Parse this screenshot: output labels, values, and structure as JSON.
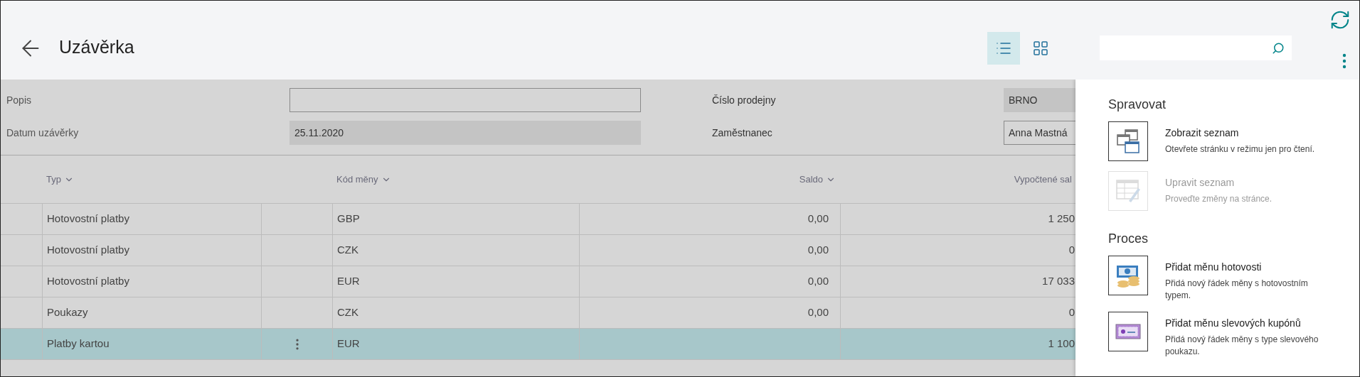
{
  "header": {
    "title": "Uzávěrka",
    "views": [
      {
        "kind": "list",
        "selected": true
      },
      {
        "kind": "tiles",
        "selected": false
      }
    ]
  },
  "form": {
    "left": [
      {
        "label": "Popis",
        "kind": "input"
      },
      {
        "label": "Datum uzávěrky",
        "kind": "readonly",
        "value": "25.11.2020"
      }
    ],
    "right": [
      {
        "label": "Číslo prodejny",
        "kind": "readonly",
        "value": "BRNO"
      },
      {
        "label": "Zaměstnanec",
        "kind": "input",
        "value": "Anna Mastná"
      }
    ]
  },
  "table": {
    "columns": [
      {
        "label": "Typ",
        "sort_menu": true
      },
      {
        "label": "Kód měny",
        "sort_menu": true
      },
      {
        "label": "Saldo",
        "sort_menu": true
      },
      {
        "label": "Vypočtené sal",
        "sort_menu": false
      }
    ],
    "rows": [
      {
        "type": "Hotovostní platby",
        "currency": "GBP",
        "balance": "0,00",
        "calculated": "1 250",
        "selected": false
      },
      {
        "type": "Hotovostní platby",
        "currency": "CZK",
        "balance": "0,00",
        "calculated": "0",
        "selected": false
      },
      {
        "type": "Hotovostní platby",
        "currency": "EUR",
        "balance": "0,00",
        "calculated": "17 033",
        "selected": false
      },
      {
        "type": "Poukazy",
        "currency": "CZK",
        "balance": "0,00",
        "calculated": "0",
        "selected": false
      },
      {
        "type": "Platby kartou",
        "currency": "EUR",
        "calculated": "1 100",
        "selected": true
      }
    ]
  },
  "menu": {
    "sections": [
      {
        "title": "Spravovat",
        "items": [
          {
            "kind": "view-list",
            "title": "Zobrazit seznam",
            "description": "Otevřete stránku v režimu jen pro čtení.",
            "disabled": false
          },
          {
            "kind": "edit-list",
            "title": "Upravit seznam",
            "description": "Proveďte změny na stránce.",
            "disabled": true
          }
        ]
      },
      {
        "title": "Proces",
        "items": [
          {
            "kind": "cash",
            "title": "Přidat měnu hotovosti",
            "description": "Přidá nový řádek měny s hotovostním typem.",
            "disabled": false
          },
          {
            "kind": "coupon",
            "title": "Přidat měnu slevových kupónů",
            "description": "Přidá nový řádek měny s type slevového poukazu.",
            "disabled": false
          }
        ]
      }
    ]
  }
}
